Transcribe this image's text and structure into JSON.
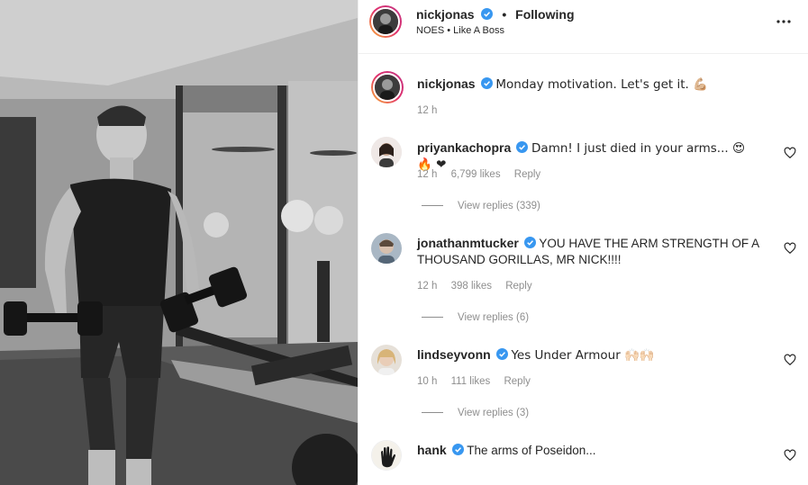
{
  "post": {
    "author": "nickjonas",
    "follow_status": "Following",
    "separator": "•",
    "audio": "NOES • Like A Boss"
  },
  "caption": {
    "username": "nickjonas",
    "text": "Monday motivation. Let's get it. 💪🏼",
    "time": "12 h"
  },
  "comments": [
    {
      "username": "priyankachopra",
      "text": "Damn! I just died in your arms... 😍 🔥 ❤",
      "time": "12 h",
      "likes": "6,799 likes",
      "reply": "Reply",
      "view_replies": "View replies (339)"
    },
    {
      "username": "jonathanmtucker",
      "text": "YOU HAVE THE ARM STRENGTH OF A THOUSAND GORILLAS, MR NICK!!!!",
      "time": "12 h",
      "likes": "398 likes",
      "reply": "Reply",
      "view_replies": "View replies (6)"
    },
    {
      "username": "lindseyvonn",
      "text": "Yes Under Armour 🙌🏻🙌🏻",
      "time": "10 h",
      "likes": "111 likes",
      "reply": "Reply",
      "view_replies": "View replies (3)"
    },
    {
      "username": "hank",
      "text": "The arms of Poseidon..."
    }
  ],
  "icons": {
    "verified": "verified-badge-icon",
    "more": "more-options-icon",
    "like": "heart-outline-icon"
  },
  "colors": {
    "verified_blue": "#3897f0",
    "meta_gray": "#8e8e8e",
    "text": "#262626"
  }
}
